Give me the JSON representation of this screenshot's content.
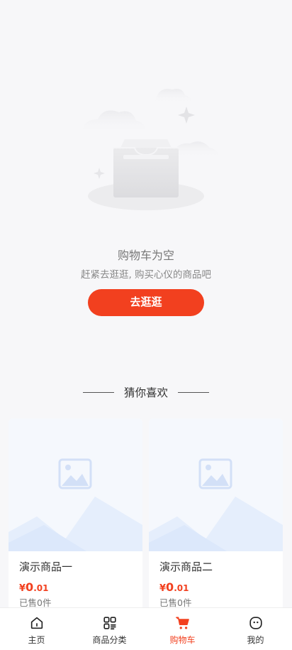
{
  "empty_cart": {
    "title": "购物车为空",
    "subtitle": "赶紧去逛逛, 购买心仪的商品吧",
    "button_label": "去逛逛"
  },
  "recommend": {
    "heading": "猜你喜欢",
    "products": [
      {
        "name": "演示商品一",
        "currency": "¥",
        "price_int": "0",
        "price_dec": ".01",
        "sold": "已售0件"
      },
      {
        "name": "演示商品二",
        "currency": "¥",
        "price_int": "0",
        "price_dec": ".01",
        "sold": "已售0件"
      }
    ]
  },
  "tabbar": {
    "items": [
      {
        "label": "主页",
        "icon": "home-icon",
        "active": false
      },
      {
        "label": "商品分类",
        "icon": "category-icon",
        "active": false
      },
      {
        "label": "购物车",
        "icon": "cart-icon",
        "active": true
      },
      {
        "label": "我的",
        "icon": "profile-icon",
        "active": false
      }
    ]
  },
  "colors": {
    "accent": "#f2401f",
    "background": "#f7f7f9"
  }
}
